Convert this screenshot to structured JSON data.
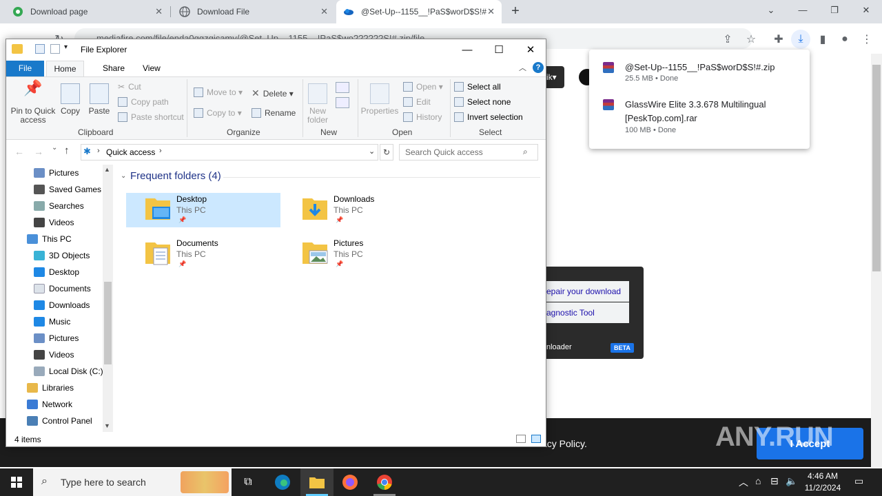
{
  "browser": {
    "tabs": [
      {
        "label": "Download page"
      },
      {
        "label": "Download File"
      },
      {
        "label": "@Set-Up--1155__!PaS$worD$S!#"
      }
    ],
    "url": "mediafire.com/file/enda0qgzgicamy/@Set_Up__1155__!PaS$wo??????S!#.zip/file"
  },
  "downloads": [
    {
      "name": "@Set-Up--1155__!PaS$worD$S!#.zip",
      "meta": "25.5 MB • Done"
    },
    {
      "name_line1": "GlassWire Elite 3.3.678 Multilingual",
      "name_line2": "[PeskTop.com].rar",
      "meta": "100 MB • Done"
    }
  ],
  "page": {
    "page_btn": "ik",
    "popup_item1": "epair your download",
    "popup_item2": "agnostic Tool",
    "popup_footer": "nloader",
    "beta": "BETA",
    "privacy": "acy Policy.",
    "accept": "I Accept",
    "watermark": "ANY.RUN"
  },
  "explorer": {
    "title": "File Explorer",
    "ribbon_tabs": {
      "file": "File",
      "home": "Home",
      "share": "Share",
      "view": "View"
    },
    "clipboard": {
      "pin": "Pin to Quick access",
      "copy": "Copy",
      "paste": "Paste",
      "cut": "Cut",
      "copy_path": "Copy path",
      "paste_shortcut": "Paste shortcut",
      "group": "Clipboard"
    },
    "organize": {
      "move_to": "Move to",
      "copy_to": "Copy to",
      "delete": "Delete",
      "rename": "Rename",
      "group": "Organize"
    },
    "new": {
      "new_folder": "New folder",
      "group": "New"
    },
    "open": {
      "properties": "Properties",
      "open": "Open",
      "edit": "Edit",
      "history": "History",
      "group": "Open"
    },
    "select": {
      "select_all": "Select all",
      "select_none": "Select none",
      "invert": "Invert selection",
      "group": "Select"
    },
    "address": "Quick access",
    "search_placeholder": "Search Quick access",
    "nav": [
      "Pictures",
      "Saved Games",
      "Searches",
      "Videos",
      "This PC",
      "3D Objects",
      "Desktop",
      "Documents",
      "Downloads",
      "Music",
      "Pictures",
      "Videos",
      "Local Disk (C:)",
      "Libraries",
      "Network",
      "Control Panel"
    ],
    "section": "Frequent folders (4)",
    "folders": [
      {
        "name": "Desktop",
        "sub": "This PC"
      },
      {
        "name": "Downloads",
        "sub": "This PC"
      },
      {
        "name": "Documents",
        "sub": "This PC"
      },
      {
        "name": "Pictures",
        "sub": "This PC"
      }
    ],
    "status": "4 items"
  },
  "taskbar": {
    "search": "Type here to search",
    "time": "4:46 AM",
    "date": "11/2/2024"
  }
}
